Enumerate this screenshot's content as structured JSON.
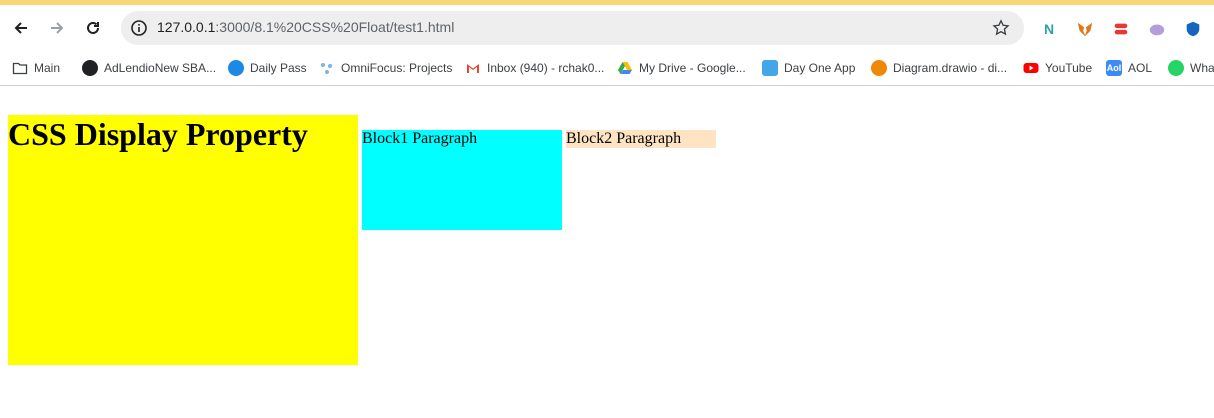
{
  "browser": {
    "url_host": "127.0.0.1",
    "url_path": ":3000/8.1%20CSS%20Float/test1.html",
    "bookmarks": [
      {
        "label": "Main",
        "icon": "folder-icon"
      },
      {
        "label": "AdLendioNew SBA...",
        "icon": "globe-icon"
      },
      {
        "label": "Daily Pass",
        "icon": "daily-pass-icon"
      },
      {
        "label": "OmniFocus: Projects",
        "icon": "omnifocus-icon"
      },
      {
        "label": "Inbox (940) - rchak0...",
        "icon": "gmail-icon"
      },
      {
        "label": "My Drive - Google...",
        "icon": "google-drive-icon"
      },
      {
        "label": "Day One App",
        "icon": "day-one-icon"
      },
      {
        "label": "Diagram.drawio - di...",
        "icon": "drawio-icon"
      },
      {
        "label": "YouTube",
        "icon": "youtube-icon"
      },
      {
        "label": "AOL",
        "icon": "aol-icon"
      },
      {
        "label": "Wha",
        "icon": "whatsapp-icon"
      }
    ]
  },
  "page": {
    "heading": "CSS Display Property",
    "block1": "Block1 Paragraph",
    "block2": "Block2 Paragraph"
  },
  "colors": {
    "heading_bg": "#ffff00",
    "block1_bg": "#00ffff",
    "block2_bg": "#ffe4c4"
  }
}
